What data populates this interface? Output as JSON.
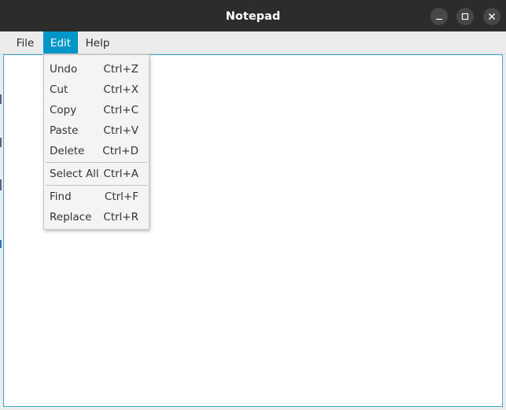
{
  "window": {
    "title": "Notepad",
    "controls": {
      "minimize": "minimize-icon",
      "maximize": "maximize-icon",
      "close": "close-icon"
    }
  },
  "menubar": {
    "file": "File",
    "edit": "Edit",
    "help": "Help"
  },
  "edit_menu": {
    "items": [
      {
        "label": "Undo",
        "shortcut": "Ctrl+Z"
      },
      {
        "label": "Cut",
        "shortcut": "Ctrl+X"
      },
      {
        "label": "Copy",
        "shortcut": "Ctrl+C"
      },
      {
        "label": "Paste",
        "shortcut": "Ctrl+V"
      },
      {
        "label": "Delete",
        "shortcut": "Ctrl+D"
      },
      {
        "label": "Select All",
        "shortcut": "Ctrl+A"
      },
      {
        "label": "Find",
        "shortcut": "Ctrl+F"
      },
      {
        "label": "Replace",
        "shortcut": "Ctrl+R"
      }
    ]
  },
  "editor": {
    "text": ""
  },
  "colors": {
    "titlebar": "#2c2c2c",
    "menu_active": "#0096c9",
    "editor_border": "#39a8d2"
  }
}
